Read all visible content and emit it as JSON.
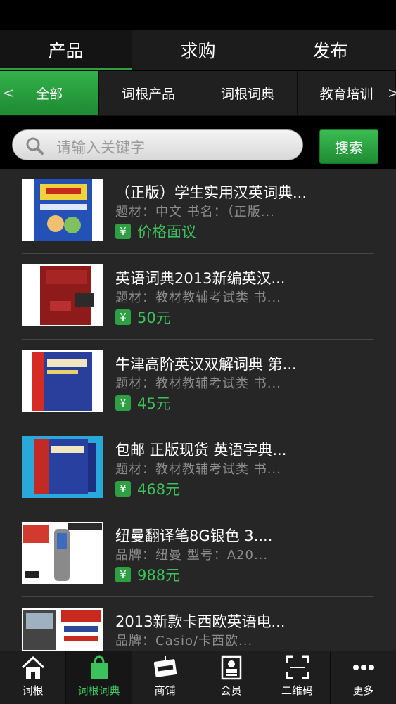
{
  "top_tabs": [
    {
      "label": "产品",
      "active": true
    },
    {
      "label": "求购",
      "active": false
    },
    {
      "label": "发布",
      "active": false
    }
  ],
  "categories": {
    "left_arrow": "<",
    "right_arrow": ">",
    "items": [
      {
        "label": "全部",
        "active": true
      },
      {
        "label": "词根产品",
        "active": false
      },
      {
        "label": "词根词典",
        "active": false
      },
      {
        "label": "教育培训",
        "active": false
      }
    ]
  },
  "search": {
    "placeholder": "请输入关键字",
    "button": "搜索"
  },
  "products": [
    {
      "title": "（正版）学生实用汉英词典...",
      "subtitle": "题材：中文  书名：（正版...",
      "price": "价格面议",
      "thumb": "book-blue-dictionary"
    },
    {
      "title": "英语词典2013新编英汉...",
      "subtitle": "题材：教材教辅考试类  书...",
      "price": "50元",
      "thumb": "book-red-dictionary"
    },
    {
      "title": "牛津高阶英汉双解词典 第...",
      "subtitle": "题材：教材教辅考试类  书...",
      "price": "45元",
      "thumb": "book-oxford-dictionary"
    },
    {
      "title": "包邮 正版现货 英语字典...",
      "subtitle": "题材：教材教辅考试类  书...",
      "price": "468元",
      "thumb": "book-oxford-box"
    },
    {
      "title": "纽曼翻译笔8G银色 3....",
      "subtitle": "品牌：纽曼  型号：A20...",
      "price": "988元",
      "thumb": "translator-pen"
    },
    {
      "title": "2013新款卡西欧英语电...",
      "subtitle": "品牌：Casio/卡西欧...",
      "price": "",
      "thumb": "electronic-dictionary"
    }
  ],
  "price_icon": "¥",
  "bottom_nav": [
    {
      "label": "词根",
      "icon": "home-icon",
      "active": false
    },
    {
      "label": "词根词典",
      "icon": "shopping-bag-icon",
      "active": true
    },
    {
      "label": "商铺",
      "icon": "open-sign-icon",
      "active": false
    },
    {
      "label": "会员",
      "icon": "member-card-icon",
      "active": false
    },
    {
      "label": "二维码",
      "icon": "qr-scan-icon",
      "active": false
    },
    {
      "label": "更多",
      "icon": "more-dots-icon",
      "active": false
    }
  ],
  "colors": {
    "accent": "#2ea043",
    "price": "#3cc25a",
    "background": "#262626"
  }
}
